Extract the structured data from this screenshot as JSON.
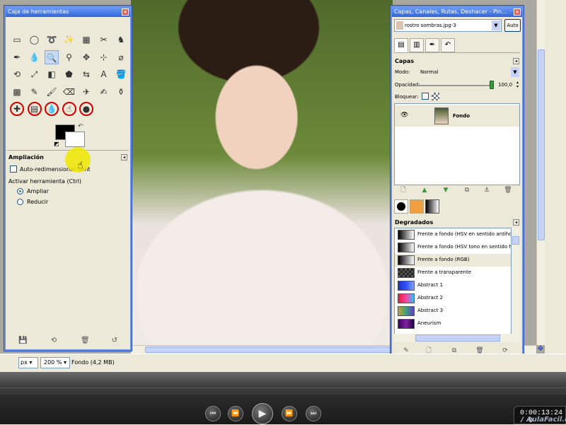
{
  "toolbox": {
    "title": "Caja de herramientas",
    "close": "×",
    "tools": [
      {
        "glyph": "▭",
        "name": "rect-select-tool-icon"
      },
      {
        "glyph": "◯",
        "name": "ellipse-select-tool-icon"
      },
      {
        "glyph": "➰",
        "name": "free-select-tool-icon"
      },
      {
        "glyph": "✨",
        "name": "fuzzy-select-tool-icon"
      },
      {
        "glyph": "▦",
        "name": "select-by-color-tool-icon"
      },
      {
        "glyph": "✂",
        "name": "scissors-tool-icon"
      },
      {
        "glyph": "♞",
        "name": "foreground-select-tool-icon"
      },
      {
        "glyph": "✒",
        "name": "paths-tool-icon"
      },
      {
        "glyph": "💧",
        "name": "color-picker-tool-icon"
      },
      {
        "glyph": "🔍",
        "name": "zoom-tool-icon"
      },
      {
        "glyph": "⚲",
        "name": "measure-tool-icon"
      },
      {
        "glyph": "✥",
        "name": "move-tool-icon"
      },
      {
        "glyph": "⊹",
        "name": "align-tool-icon"
      },
      {
        "glyph": "⌀",
        "name": "crop-tool-icon"
      },
      {
        "glyph": "⟲",
        "name": "rotate-tool-icon"
      },
      {
        "glyph": "⤢",
        "name": "scale-tool-icon"
      },
      {
        "glyph": "◧",
        "name": "shear-tool-icon"
      },
      {
        "glyph": "⬟",
        "name": "perspective-tool-icon"
      },
      {
        "glyph": "⇆",
        "name": "flip-tool-icon"
      },
      {
        "glyph": "A",
        "name": "text-tool-icon"
      },
      {
        "glyph": "🪣",
        "name": "bucket-fill-tool-icon"
      },
      {
        "glyph": "▩",
        "name": "blend-tool-icon"
      },
      {
        "glyph": "✎",
        "name": "pencil-tool-icon"
      },
      {
        "glyph": "🖌",
        "name": "paintbrush-tool-icon"
      },
      {
        "glyph": "⌫",
        "name": "eraser-tool-icon"
      },
      {
        "glyph": "✈",
        "name": "airbrush-tool-icon"
      },
      {
        "glyph": "✍",
        "name": "ink-tool-icon"
      },
      {
        "glyph": "⚱",
        "name": "clone-tool-icon"
      },
      {
        "glyph": "✚",
        "name": "heal-tool-icon"
      },
      {
        "glyph": "▤",
        "name": "perspective-clone-tool-icon"
      },
      {
        "glyph": "💧",
        "name": "blur-sharpen-tool-icon"
      },
      {
        "glyph": "☝",
        "name": "smudge-tool-icon"
      },
      {
        "glyph": "●",
        "name": "dodge-burn-tool-icon"
      }
    ],
    "fg_color": "#000000",
    "bg_color": "#ffffff",
    "options_title": "Ampliación",
    "autoresize_label": "Auto-redimensionar vent",
    "activate_label": "Activar herramienta  (Ctrl)",
    "option_zoom_in": "Ampliar",
    "option_zoom_out": "Reducir"
  },
  "layers_dock": {
    "title": "Capas, Canales, Rutas, Deshacer - Pin...",
    "close": "×",
    "image_selector": "rostro sombras.jpg-3",
    "auto_button": "Auto",
    "layers_title": "Capas",
    "mode_label": "Modo:",
    "mode_value": "Normal",
    "opacity_label": "Opacidad:",
    "opacity_value": "100,0",
    "lock_label": "Bloquear:",
    "layer_name": "Fondo",
    "gradients_title": "Degradados",
    "gradients": [
      "Frente a fondo (HSV en sentido antihorario)",
      "Frente a fondo (HSV tono en sentido horario)",
      "Frente a fondo (RGB)",
      "Frente a transparente",
      "Abstract 1",
      "Abstract 2",
      "Abstract 3",
      "Aneurism"
    ],
    "selected_gradient": "Frente a fondo (RGB)"
  },
  "statusbar": {
    "unit": "px",
    "zoom": "200 %",
    "info": "Fondo (4,2 MB)"
  },
  "player": {
    "time": "0:00:13:24 / 0",
    "watermark": "AulaFacil.com"
  },
  "colors": {
    "title_bar": "#2f66dc",
    "highlight": "#f0e600",
    "circle_mark": "#d00000"
  }
}
